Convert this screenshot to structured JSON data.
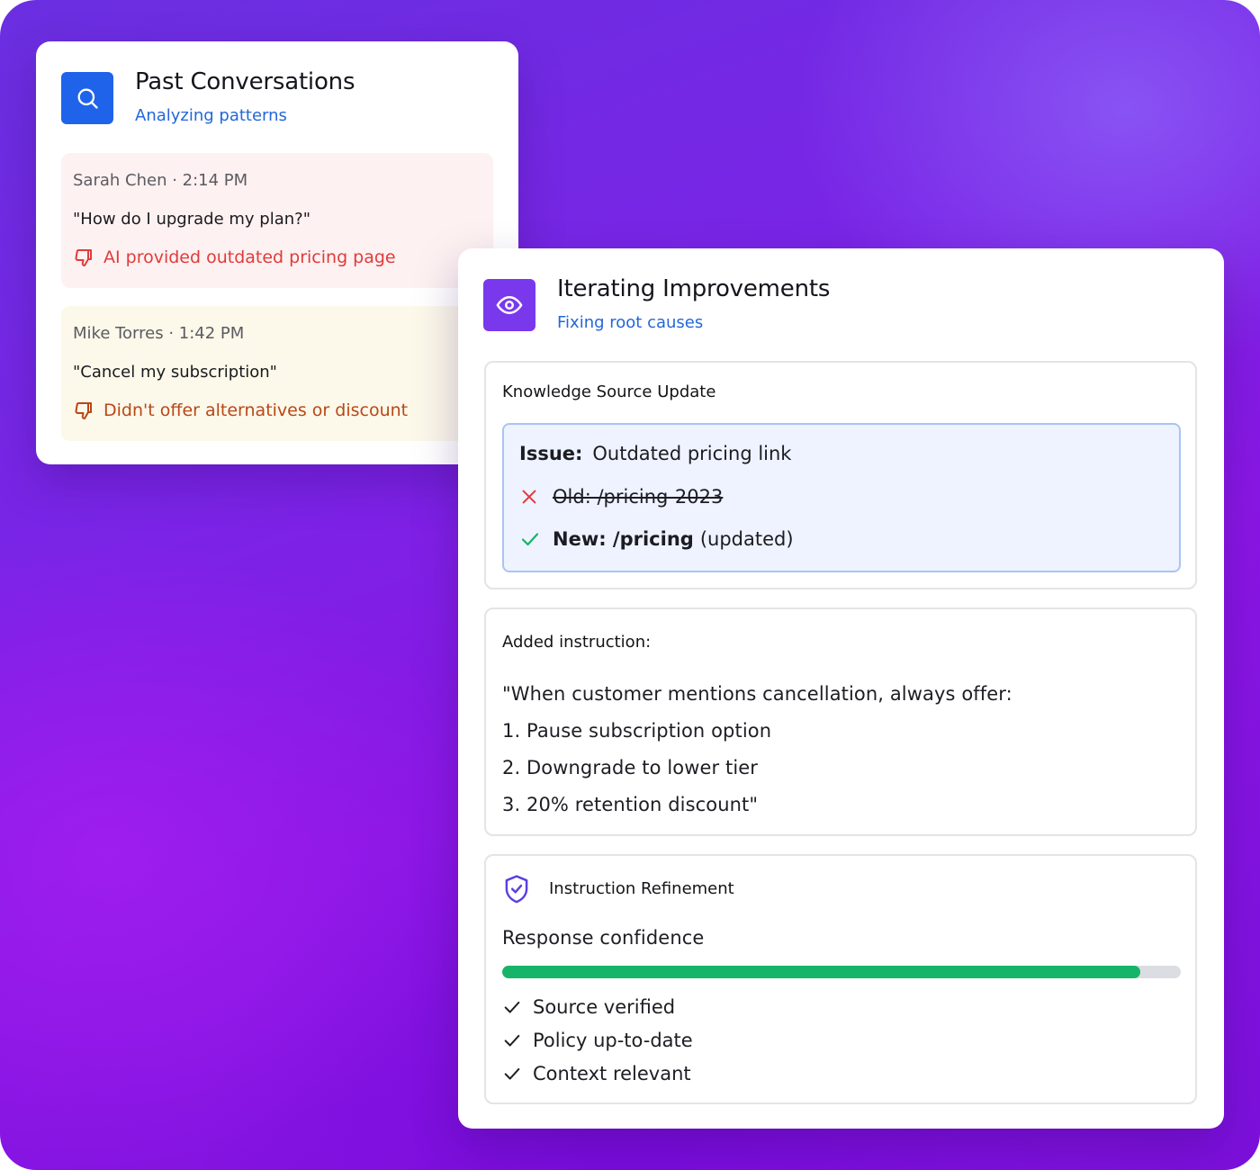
{
  "colors": {
    "search_tile": "#1f63ea",
    "eye_tile": "#7a38ec",
    "subtitle": "#2367d8",
    "negative": "#e03b3b",
    "warning": "#b84816",
    "success": "#16b468"
  },
  "past": {
    "title": "Past Conversations",
    "subtitle": "Analyzing patterns",
    "icon": "search-icon",
    "items": [
      {
        "meta": "Sarah Chen · 2:14 PM",
        "quote": "\"How do I upgrade my plan?\"",
        "flag": "AI provided outdated pricing page",
        "icon": "thumbs-down-icon"
      },
      {
        "meta": "Mike Torres · 1:42 PM",
        "quote": "\"Cancel my subscription\"",
        "flag": "Didn't offer alternatives or discount",
        "icon": "thumbs-down-icon"
      }
    ]
  },
  "iter": {
    "title": "Iterating Improvements",
    "subtitle": "Fixing root causes",
    "icon": "eye-icon",
    "knowledge": {
      "title": "Knowledge Source Update",
      "issue_label": "Issue:",
      "issue_text": "Outdated pricing link",
      "old_text": "Old: /pricing-2023",
      "new_label": "New: /pricing",
      "new_suffix": "(updated)"
    },
    "instruction": {
      "title": "Added instruction:",
      "lines": [
        "\"When customer mentions cancellation, always offer:",
        "1. Pause subscription option",
        "2. Downgrade to lower tier",
        "3. 20% retention discount\""
      ]
    },
    "refinement": {
      "title": "Instruction Refinement",
      "icon": "shield-check-icon",
      "confidence_label": "Response confidence",
      "confidence_value": 0.94,
      "checks": [
        "Source verified",
        "Policy up-to-date",
        "Context relevant"
      ]
    }
  }
}
